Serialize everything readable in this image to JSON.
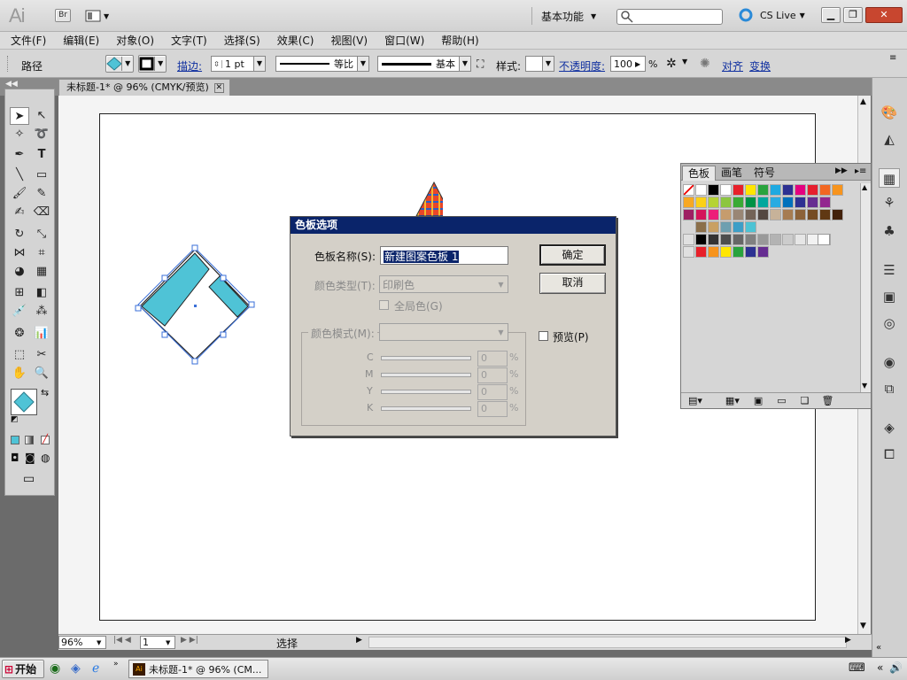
{
  "app": {
    "logo": "Ai",
    "bridge_label": "Br",
    "workspace": "基本功能",
    "cs_live": "CS Live"
  },
  "menu": [
    "文件(F)",
    "编辑(E)",
    "对象(O)",
    "文字(T)",
    "选择(S)",
    "效果(C)",
    "视图(V)",
    "窗口(W)",
    "帮助(H)"
  ],
  "control_bar": {
    "object_type": "路径",
    "stroke_label": "描边:",
    "stroke_weight": "1 pt",
    "variable_width": "等比",
    "brush": "基本",
    "style_label": "样式:",
    "opacity_label": "不透明度:",
    "opacity_value": "100",
    "opacity_unit": "%",
    "align_label": "对齐",
    "transform_label": "变换"
  },
  "document": {
    "tab_title": "未标题-1* @ 96% (CMYK/预览)"
  },
  "status_bar": {
    "zoom": "96%",
    "artboard_number": "1",
    "status_text": "选择"
  },
  "taskbar": {
    "start_label": "开始",
    "task_item": "未标题-1* @ 96% (CM..."
  },
  "swatches_panel": {
    "tabs": [
      "色板",
      "画笔",
      "符号"
    ],
    "row1": [
      "none",
      "#ffffff",
      "#000000",
      "#ffffff",
      "#e8202a",
      "#ffe600",
      "#29a33d",
      "#1ea9e1",
      "#2d3192",
      "#e4007f",
      "#e61e2e",
      "#f26722",
      "#f7941d"
    ],
    "row2": [
      "#f7a823",
      "#fcd116",
      "#b5d334",
      "#8cc63f",
      "#3aaa35",
      "#009245",
      "#00a79d",
      "#29abe2",
      "#0071bc",
      "#2e3192",
      "#662d91",
      "#93278f"
    ],
    "row3": [
      "#9e1f63",
      "#d4145a",
      "#ed1e79",
      "#c69c6d",
      "#998675",
      "#736357",
      "#534741",
      "#c7b299",
      "#a67c52",
      "#8c6239",
      "#754c24",
      "#603813",
      "#42210b"
    ],
    "row4": [
      "#8b6f4a",
      "#c9a063",
      "#6e9fb0",
      "#3d9ec7",
      "#4dc3d4"
    ],
    "row5": [
      "#000000",
      "#333333",
      "#4d4d4d",
      "#666666",
      "#808080",
      "#999999",
      "#b3b3b3",
      "#cccccc",
      "#e6e6e6",
      "#f2f2f2",
      "#ffffff"
    ],
    "row6": [
      "#e8202a",
      "#f7941d",
      "#ffe600",
      "#29a33d",
      "#2d3192",
      "#662d91"
    ]
  },
  "dialog": {
    "title": "色板选项",
    "name_label": "色板名称(S):",
    "name_value": "新建图案色板 1",
    "color_type_label": "颜色类型(T):",
    "color_type_value": "印刷色",
    "global_label": "全局色(G)",
    "color_mode_label": "颜色模式(M):",
    "preview_label": "预览(P)",
    "ok_label": "确定",
    "cancel_label": "取消",
    "channels": [
      {
        "label": "C",
        "value": "0",
        "unit": "%"
      },
      {
        "label": "M",
        "value": "0",
        "unit": "%"
      },
      {
        "label": "Y",
        "value": "0",
        "unit": "%"
      },
      {
        "label": "K",
        "value": "0",
        "unit": "%"
      }
    ]
  },
  "colors": {
    "selection_blue": "#3a6fd8",
    "shape_fill": "#4fc3d6",
    "dialog_title_bg": "#0a246a"
  }
}
